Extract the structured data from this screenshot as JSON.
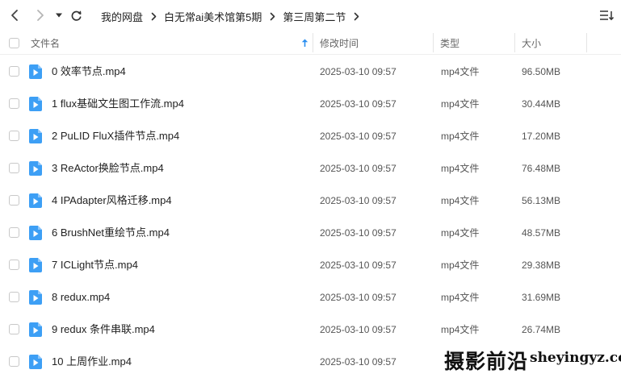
{
  "navigation": {
    "back_icon": "chevron-left-icon",
    "forward_icon": "chevron-right-icon",
    "history_icon": "caret-down-icon",
    "refresh_icon": "refresh-icon",
    "sort_menu_icon": "list-sort-icon"
  },
  "breadcrumb": {
    "items": [
      "我的网盘",
      "白无常ai美术馆第5期",
      "第三周第二节"
    ],
    "separator_icon": "chevron-right-icon"
  },
  "columns": {
    "name": "文件名",
    "modified": "修改时间",
    "type": "类型",
    "size": "大小",
    "sort_icon": "sort-ascending-arrow-icon"
  },
  "files": [
    {
      "name": "0 效率节点.mp4",
      "modified": "2025-03-10 09:57",
      "type": "mp4文件",
      "size": "96.50MB"
    },
    {
      "name": "1 flux基础文生图工作流.mp4",
      "modified": "2025-03-10 09:57",
      "type": "mp4文件",
      "size": "30.44MB"
    },
    {
      "name": "2 PuLID FluX插件节点.mp4",
      "modified": "2025-03-10 09:57",
      "type": "mp4文件",
      "size": "17.20MB"
    },
    {
      "name": "3 ReActor换脸节点.mp4",
      "modified": "2025-03-10 09:57",
      "type": "mp4文件",
      "size": "76.48MB"
    },
    {
      "name": "4 IPAdapter风格迁移.mp4",
      "modified": "2025-03-10 09:57",
      "type": "mp4文件",
      "size": "56.13MB"
    },
    {
      "name": "6 BrushNet重绘节点.mp4",
      "modified": "2025-03-10 09:57",
      "type": "mp4文件",
      "size": "48.57MB"
    },
    {
      "name": "7 ICLight节点.mp4",
      "modified": "2025-03-10 09:57",
      "type": "mp4文件",
      "size": "29.38MB"
    },
    {
      "name": "8 redux.mp4",
      "modified": "2025-03-10 09:57",
      "type": "mp4文件",
      "size": "31.69MB"
    },
    {
      "name": "9 redux 条件串联.mp4",
      "modified": "2025-03-10 09:57",
      "type": "mp4文件",
      "size": "26.74MB"
    },
    {
      "name": "10 上周作业.mp4",
      "modified": "2025-03-10 09:57",
      "type": "",
      "size": ""
    }
  ],
  "file_icon": "video-file-icon",
  "watermark": {
    "chinese": "摄影前沿",
    "latin": "sheyingyz.com"
  },
  "colors": {
    "file_icon_blue": "#3d9ff5",
    "sort_arrow_blue": "#2c8ff0",
    "header_text": "#666666",
    "row_text": "#222222"
  }
}
